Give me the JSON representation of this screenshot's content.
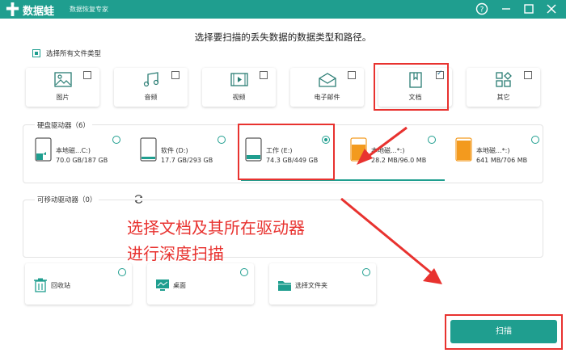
{
  "app": {
    "brand": "数据蛙",
    "slogan": "数据恢复专家"
  },
  "window_controls": [
    "help-icon",
    "minimize-icon",
    "maximize-icon",
    "close-icon"
  ],
  "headline": "选择要扫描的丢失数据的数据类型和路径。",
  "select_all": {
    "label": "选择所有文件类型",
    "checked": true
  },
  "file_types": [
    {
      "label": "图片",
      "icon": "image-icon",
      "checked": false
    },
    {
      "label": "音频",
      "icon": "music-icon",
      "checked": false
    },
    {
      "label": "视频",
      "icon": "video-icon",
      "checked": false
    },
    {
      "label": "电子邮件",
      "icon": "email-icon",
      "checked": false
    },
    {
      "label": "文档",
      "icon": "document-icon",
      "checked": true
    },
    {
      "label": "其它",
      "icon": "other-icon",
      "checked": false
    }
  ],
  "hard_drives": {
    "title": "硬盘驱动器（6）",
    "items": [
      {
        "name": "本地磁...C:)",
        "size": "70.0 GB/187 GB",
        "selected": false
      },
      {
        "name": "软件 (D:)",
        "size": "17.7 GB/293 GB",
        "selected": false
      },
      {
        "name": "工作 (E:)",
        "size": "74.3 GB/449 GB",
        "selected": true
      },
      {
        "name": "本地磁...*:)",
        "size": "28.2 MB/96.0 MB",
        "selected": false
      },
      {
        "name": "本地磁...*:)",
        "size": "641 MB/706 MB",
        "selected": false
      }
    ]
  },
  "removable": {
    "title": "可移动驱动器（0）",
    "refresh_icon": "refresh-icon"
  },
  "locations": [
    {
      "name": "回收站",
      "icon": "recycle-bin-icon"
    },
    {
      "name": "桌面",
      "icon": "desktop-icon"
    },
    {
      "name": "选择文件夹",
      "icon": "folder-icon"
    }
  ],
  "annotation": {
    "line1": "选择文档及其所在驱动器",
    "line2": "进行深度扫描"
  },
  "scan_button": "扫描",
  "colors": {
    "accent": "#1f9e8f",
    "annotation_red": "#e8322f",
    "orange_drive": "#f39a1e"
  }
}
